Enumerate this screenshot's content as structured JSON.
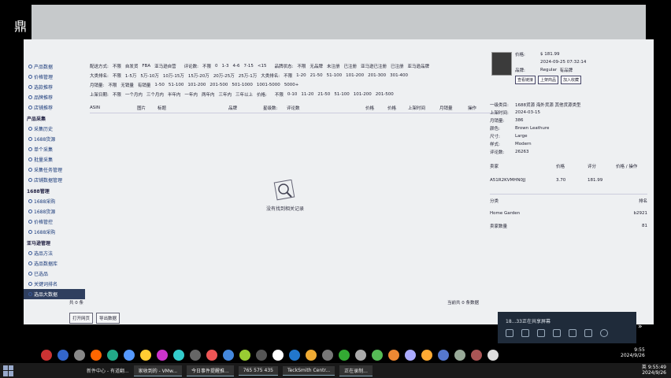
{
  "top_title": "鼎",
  "sidebar": {
    "items_top": [
      "产品数据",
      "价格管理",
      "选款推荐",
      "品牌推荐",
      "店铺推荐"
    ],
    "group1": {
      "title": "产品采集",
      "items": [
        "采集历史",
        "1688货源",
        "单个采集",
        "批量采集",
        "采集任务管理",
        "店铺数据管理"
      ]
    },
    "group2": {
      "title": "1688管理",
      "items": [
        "1688采购",
        "1688货源",
        "价格管控",
        "1688采购"
      ]
    },
    "group3": {
      "title": "亚马逊管理",
      "items": [
        "选品方法",
        "选品数据库",
        "已选品",
        "关键词排名",
        "选品大数据"
      ]
    }
  },
  "filters": {
    "row1": [
      "配送方式:",
      "不限",
      "自发货",
      "FBA",
      "亚马逊自营",
      "",
      "评论数:",
      "不限",
      "0",
      "1-3",
      "4-6",
      "7-15",
      "<15",
      "",
      "品牌状态:",
      "不限",
      "无品牌",
      "未注册",
      "已注册",
      "亚马逊已注册",
      "已注册",
      "亚马逊品牌"
    ],
    "row2": [
      "大类排名:",
      "不限",
      "1-5万",
      "5万-10万",
      "10万-15万",
      "15万-20万",
      "20万-25万",
      "25万-1万",
      "大类排名:",
      "不限",
      "1-20",
      "21-50",
      "51-100",
      "101-200",
      "201-300",
      "301-400"
    ],
    "row3": [
      "月销量:",
      "不限",
      "无销量",
      "有销量",
      "1-50",
      "51-100",
      "101-200",
      "201-500",
      "501-1000",
      "1001-5000",
      "5000+"
    ],
    "row4": [
      "上架日期:",
      "不限",
      "一个月内",
      "三个月内",
      "半年内",
      "一年内",
      "两年内",
      "三年内",
      "三年以上",
      "价格:",
      "",
      "不限",
      "0-10",
      "11-20",
      "21-50",
      "51-100",
      "101-200",
      "201-500"
    ]
  },
  "table": {
    "columns": [
      "ASIN",
      "图片",
      "标题",
      "品牌",
      "星级数:",
      "评论数",
      "",
      "价格",
      "价格",
      "上架时间",
      "月销量",
      "操作"
    ],
    "empty_text": "没有找到相关记录"
  },
  "footer": {
    "left": "共 0 条",
    "right": "当前共 0 条数据",
    "buttons": [
      "打开网页",
      "导出数据"
    ]
  },
  "right_panel": {
    "buttons": [
      "查看链接",
      "上架商品",
      "加入收藏"
    ],
    "fields": [
      {
        "k": "价格:",
        "v": "$ 181.99"
      },
      {
        "k": "",
        "v": "2024-09-25 07:32:14"
      },
      {
        "k": "品牌:",
        "v": "Regular",
        "v2": "有品牌"
      }
    ],
    "details": [
      {
        "k": "一级类目:",
        "v": "1688货源  海外货源  其他货源类型"
      },
      {
        "k": "上架时间:",
        "v": "2024-03-15"
      },
      {
        "k": "月销量:",
        "v": "386"
      },
      {
        "k": "颜色:",
        "v": "Brown Leathure"
      },
      {
        "k": "尺寸:",
        "v": "Large"
      },
      {
        "k": "样式:",
        "v": "Modern"
      },
      {
        "k": "评论数:",
        "v": "26263"
      }
    ],
    "mini_table": {
      "headers": [
        "卖家",
        "",
        "价格",
        "评分",
        "价格 / 操作"
      ],
      "rows": [
        [
          "A51R2KVMHN0JJ",
          "",
          "3.70",
          "181.99",
          ""
        ],
        [
          "",
          "",
          "",
          "",
          ""
        ]
      ]
    },
    "category_header": [
      "分类",
      "排名"
    ],
    "category_rows": [
      [
        "Home Garden",
        "b2921"
      ],
      [
        "卖家数量",
        "81"
      ]
    ]
  },
  "notification": {
    "text": "18...33正在共享屏幕"
  },
  "clock": {
    "time": "9:55",
    "date": "2024/9/26"
  },
  "taskbar": {
    "items": [
      "新件中心 - 有道翻...",
      "家收到的 - VMw...",
      "今日事件提醒推...",
      "765 575 435",
      "TeckSmith Centr...",
      "正在录制..."
    ],
    "time": "9:55:49",
    "date": "2024/9/26",
    "lang": "英"
  }
}
